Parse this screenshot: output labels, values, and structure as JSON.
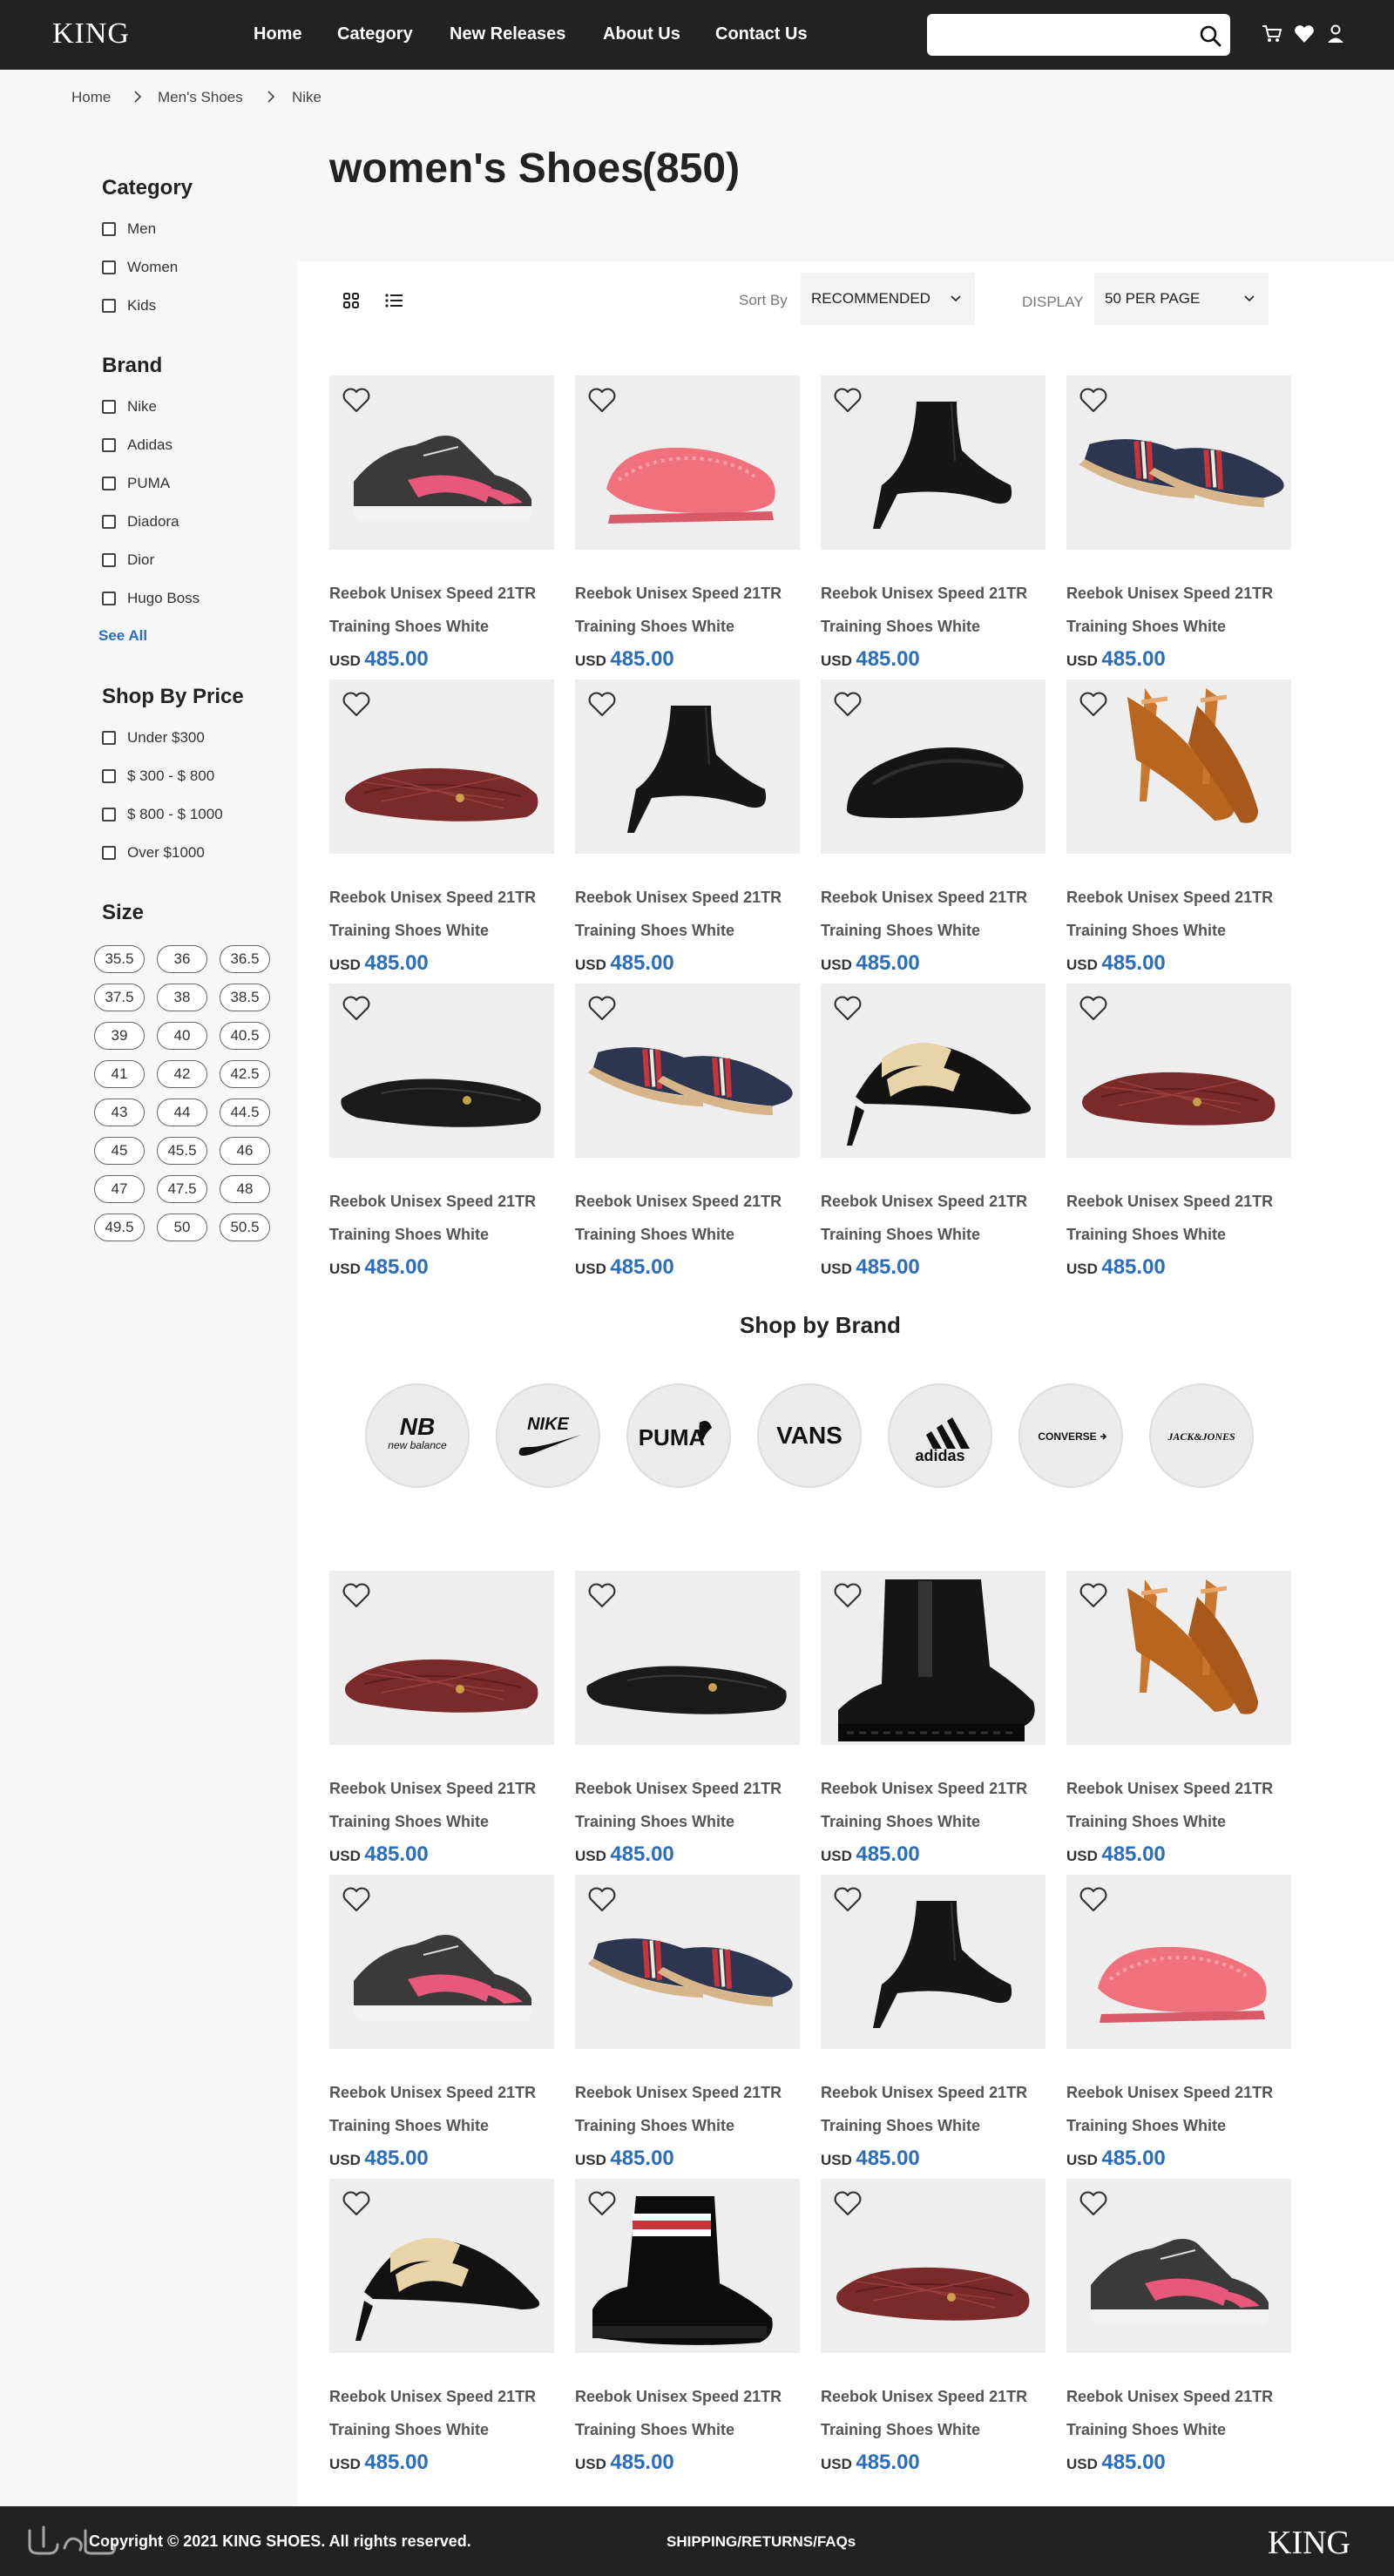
{
  "header": {
    "logo": "KING",
    "nav": [
      "Home",
      "Category",
      "New Releases",
      "About Us",
      "Contact Us"
    ],
    "search_placeholder": ""
  },
  "breadcrumb": [
    "Home",
    "Men's Shoes",
    "Nike"
  ],
  "page": {
    "title": "women's Shoes",
    "count": "(850)"
  },
  "sidebar": {
    "category_title": "Category",
    "categories": [
      "Men",
      "Women",
      "Kids"
    ],
    "brand_title": "Brand",
    "brands": [
      "Nike",
      "Adidas",
      "PUMA",
      "Diadora",
      "Dior",
      "Hugo Boss"
    ],
    "see_all": "See All",
    "price_title": "Shop By Price",
    "prices": [
      "Under $300",
      "$ 300 - $ 800",
      "$ 800 - $ 1000",
      "Over $1000"
    ],
    "size_title": "Size",
    "sizes": [
      "35.5",
      "36",
      "36.5",
      "37.5",
      "38",
      "38.5",
      "39",
      "40",
      "40.5",
      "41",
      "42",
      "42.5",
      "43",
      "44",
      "44.5",
      "45",
      "45.5",
      "46",
      "47",
      "47.5",
      "48",
      "49.5",
      "50",
      "50.5"
    ]
  },
  "toolbar": {
    "sort_label": "Sort By",
    "sort_value": "RECOMMENDED",
    "display_label": "DISPLAY",
    "display_value": "50 PER PAGE"
  },
  "product": {
    "name_line1": "Reebok Unisex Speed 21TR",
    "name_line2": "Training Shoes White",
    "currency": "USD",
    "price": "485.00"
  },
  "grid1": [
    "sneaker",
    "slipper",
    "bootie",
    "espadrille",
    "flat-red",
    "bootie",
    "mule",
    "heels-tan",
    "flat-black",
    "espadrille",
    "mule-heel",
    "flat-red"
  ],
  "brand_section": {
    "title": "Shop by Brand",
    "brands": [
      "new balance",
      "NIKE",
      "PUMA",
      "VANS",
      "adidas",
      "CONVERSE",
      "JACK&JONES"
    ]
  },
  "grid2": [
    "flat-red",
    "flat-black",
    "chelsea",
    "heels-tan",
    "sneaker",
    "espadrille",
    "bootie",
    "slipper",
    "mule-heel",
    "rainboot",
    "flat-red",
    "sneaker"
  ],
  "footer": {
    "copyright": "Copyright © 2021 KING SHOES. All rights reserved.",
    "links": "SHIPPING/RETURNS/FAQs",
    "logo": "KING"
  },
  "colors": {
    "header": "#222222",
    "accent": "#2a6ebb"
  }
}
